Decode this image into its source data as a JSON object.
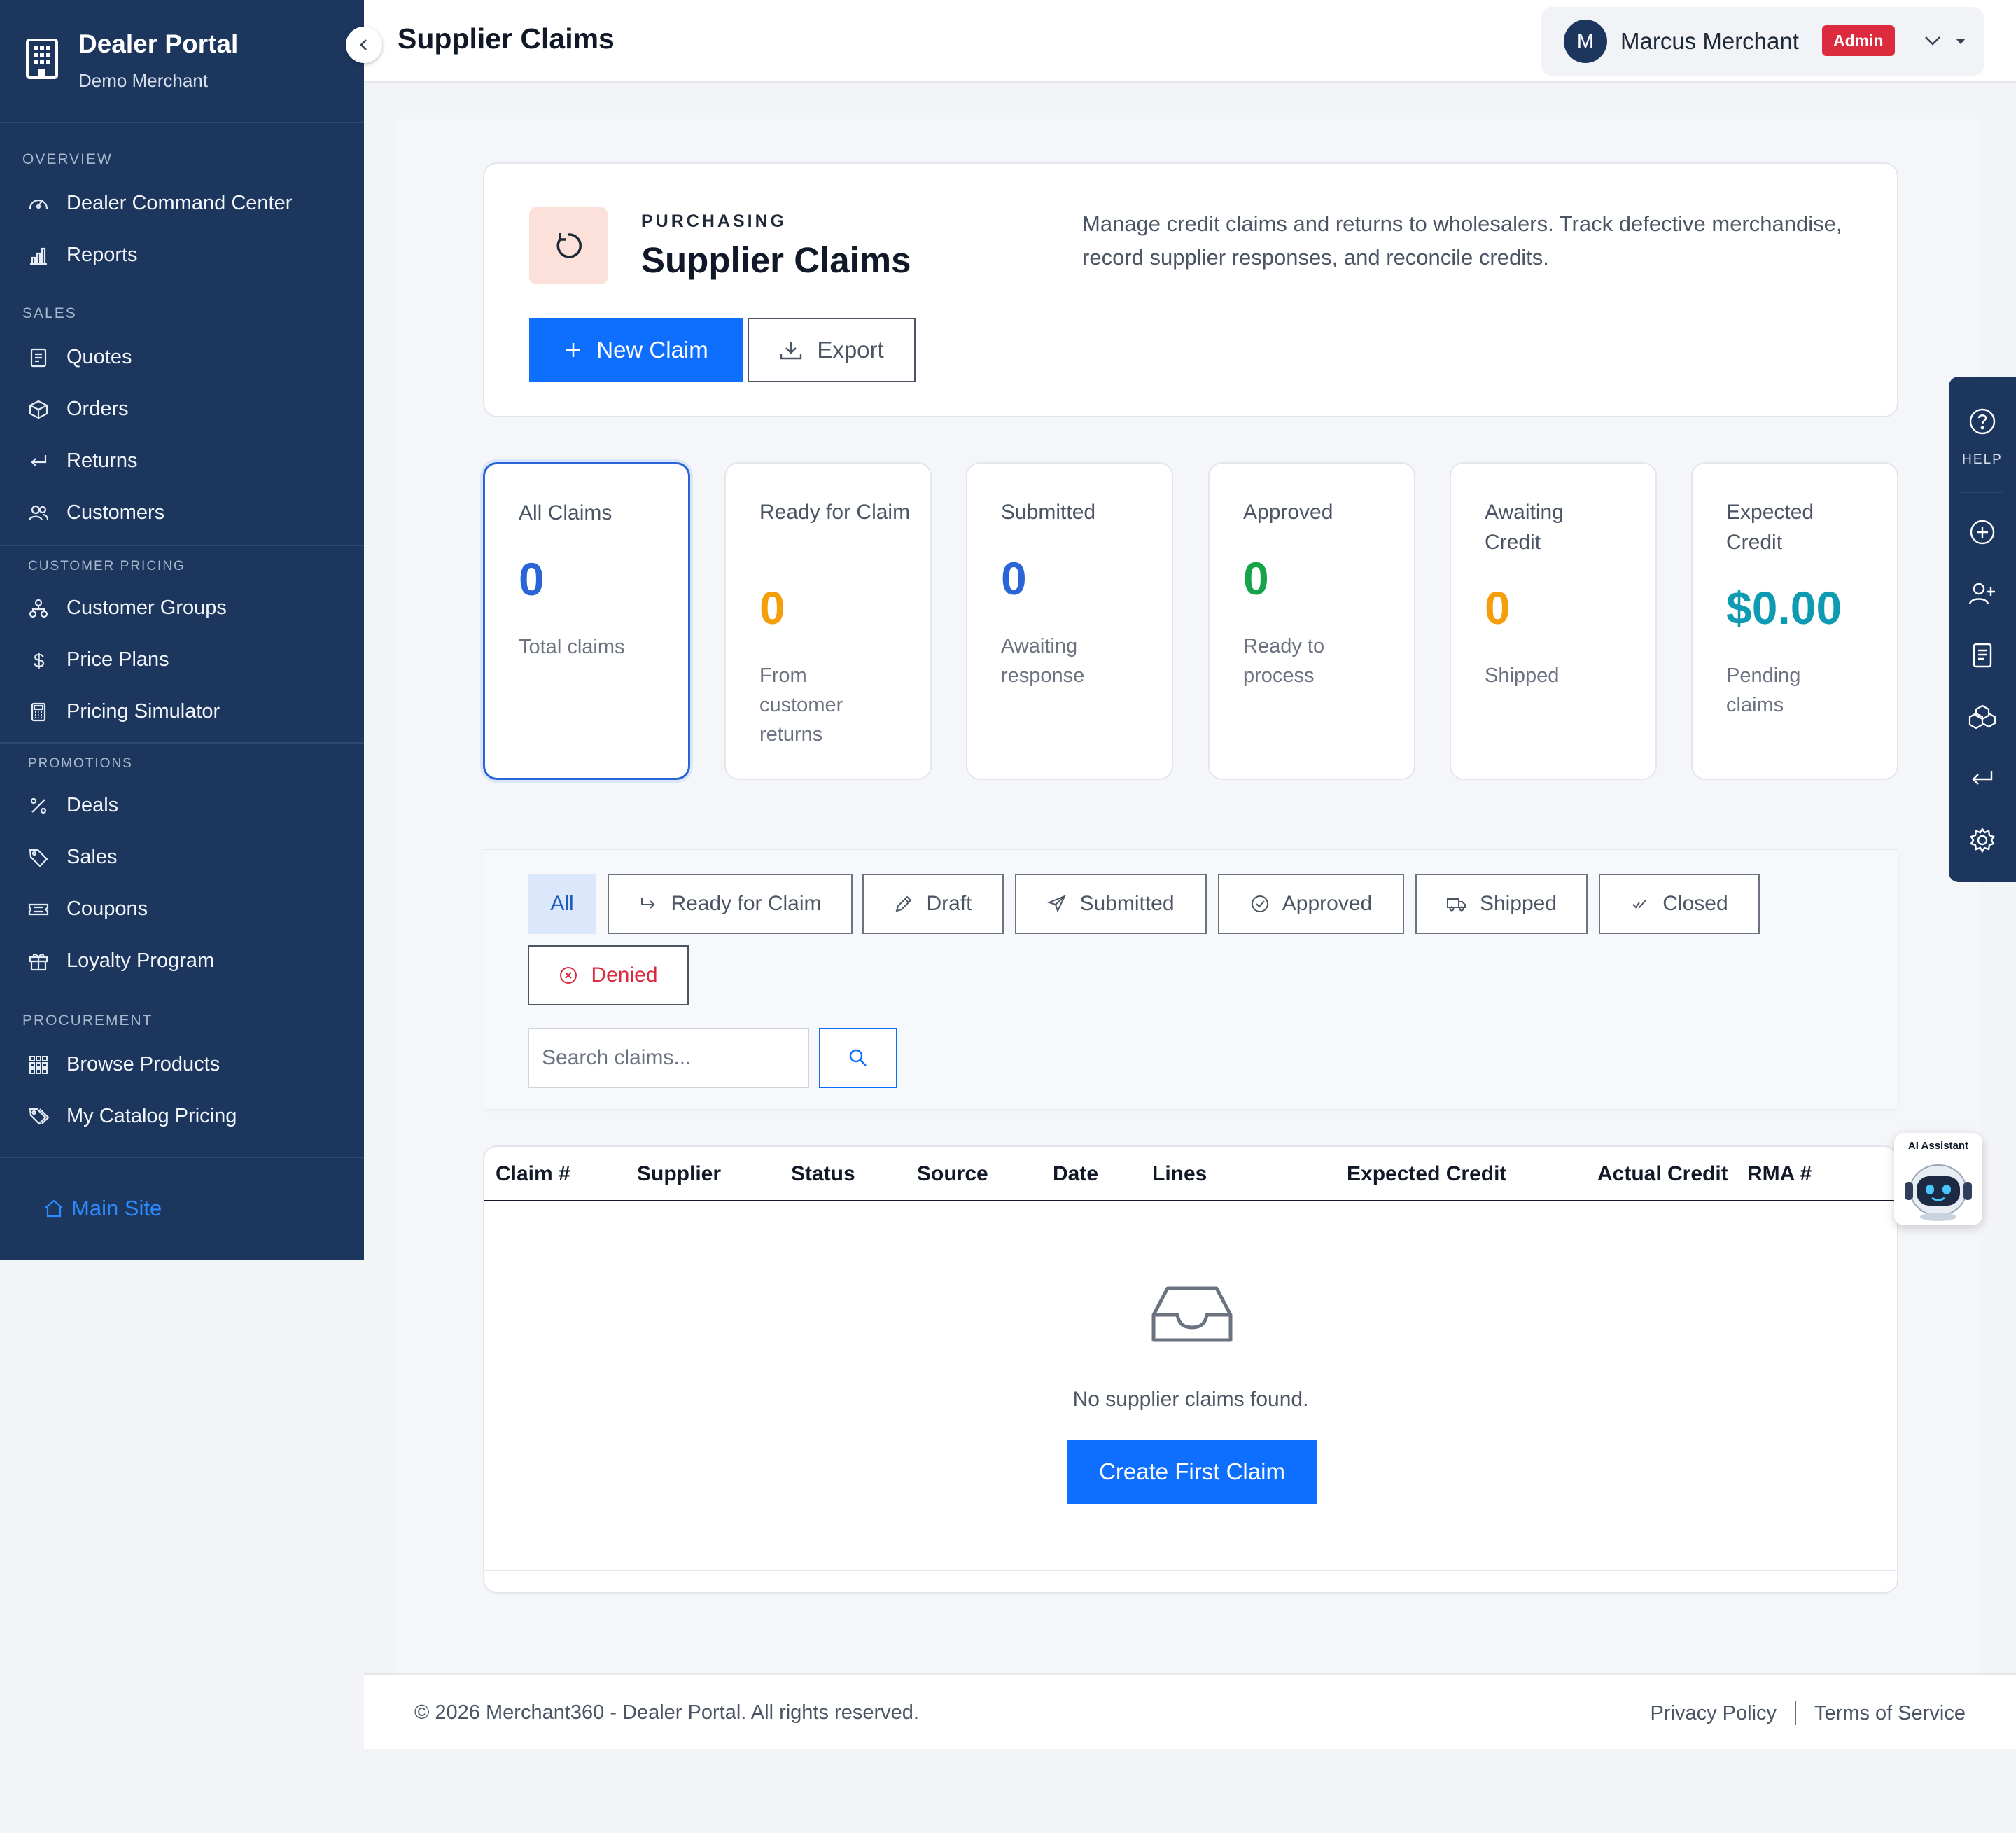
{
  "sidebar": {
    "brand_title": "Dealer Portal",
    "brand_subtitle": "Demo Merchant",
    "sections": [
      {
        "title": "OVERVIEW",
        "items": [
          {
            "label": "Dealer Command Center",
            "icon": "speedometer-icon"
          },
          {
            "label": "Reports",
            "icon": "bar-chart-icon"
          }
        ]
      },
      {
        "title": "SALES",
        "items": [
          {
            "label": "Quotes",
            "icon": "document-icon"
          },
          {
            "label": "Orders",
            "icon": "box-icon"
          },
          {
            "label": "Returns",
            "icon": "return-arrow-icon"
          },
          {
            "label": "Customers",
            "icon": "people-icon"
          }
        ]
      },
      {
        "title": "CUSTOMER PRICING",
        "items": [
          {
            "label": "Customer Groups",
            "icon": "diagram-icon"
          },
          {
            "label": "Price Plans",
            "icon": "dollar-icon"
          },
          {
            "label": "Pricing Simulator",
            "icon": "calculator-icon"
          }
        ]
      },
      {
        "title": "PROMOTIONS",
        "items": [
          {
            "label": "Deals",
            "icon": "percent-icon"
          },
          {
            "label": "Sales",
            "icon": "tag-icon"
          },
          {
            "label": "Coupons",
            "icon": "ticket-icon"
          },
          {
            "label": "Loyalty Program",
            "icon": "gift-icon"
          }
        ]
      },
      {
        "title": "PROCUREMENT",
        "items": [
          {
            "label": "Browse Products",
            "icon": "grid-icon"
          },
          {
            "label": "My Catalog Pricing",
            "icon": "tags-icon"
          }
        ]
      }
    ],
    "main_site_label": "Main Site"
  },
  "topbar": {
    "page_title": "Supplier Claims",
    "user_initial": "M",
    "user_name": "Marcus Merchant",
    "user_role": "Admin"
  },
  "hero": {
    "eyebrow": "PURCHASING",
    "title": "Supplier Claims",
    "description": "Manage credit claims and returns to wholesalers. Track defective merchandise, record supplier responses, and reconcile credits.",
    "new_claim_label": "New Claim",
    "export_label": "Export"
  },
  "stats": [
    {
      "label": "All Claims",
      "value": "0",
      "sub": "Total claims",
      "color": "#2a64d6"
    },
    {
      "label": "Ready for Claim",
      "value": "0",
      "sub": "From customer returns",
      "color": "#f59e0b"
    },
    {
      "label": "Submitted",
      "value": "0",
      "sub": "Awaiting response",
      "color": "#2a64d6"
    },
    {
      "label": "Approved",
      "value": "0",
      "sub": "Ready to process",
      "color": "#16a34a"
    },
    {
      "label": "Awaiting Credit",
      "value": "0",
      "sub": "Shipped",
      "color": "#f59e0b"
    },
    {
      "label": "Expected Credit",
      "value": "$0.00",
      "sub": "Pending claims",
      "color": "#0e9bb2"
    }
  ],
  "filters": {
    "chips": [
      {
        "label": "All",
        "icon": "",
        "active": true
      },
      {
        "label": "Ready for Claim",
        "icon": "arrow-return-right-icon"
      },
      {
        "label": "Draft",
        "icon": "pencil-icon"
      },
      {
        "label": "Submitted",
        "icon": "send-icon"
      },
      {
        "label": "Approved",
        "icon": "check-circle-icon"
      },
      {
        "label": "Shipped",
        "icon": "truck-icon"
      },
      {
        "label": "Closed",
        "icon": "double-check-icon"
      },
      {
        "label": "Denied",
        "icon": "x-circle-icon"
      }
    ],
    "search_placeholder": "Search claims..."
  },
  "table": {
    "columns": [
      "Claim #",
      "Supplier",
      "Status",
      "Source",
      "Date",
      "Lines",
      "Expected Credit",
      "Actual Credit",
      "RMA #"
    ],
    "rows": [],
    "empty_text": "No supplier claims found.",
    "empty_action_label": "Create First Claim"
  },
  "footer": {
    "copyright": "© 2026 Merchant360 - Dealer Portal. All rights reserved.",
    "privacy_label": "Privacy Policy",
    "terms_label": "Terms of Service"
  },
  "right_rail": {
    "help_label": "HELP"
  },
  "ai_widget": {
    "label": "AI Assistant"
  },
  "colors": {
    "sidebar_bg": "#1c365d",
    "primary": "#0e6efd",
    "danger": "#dc2b3f"
  }
}
